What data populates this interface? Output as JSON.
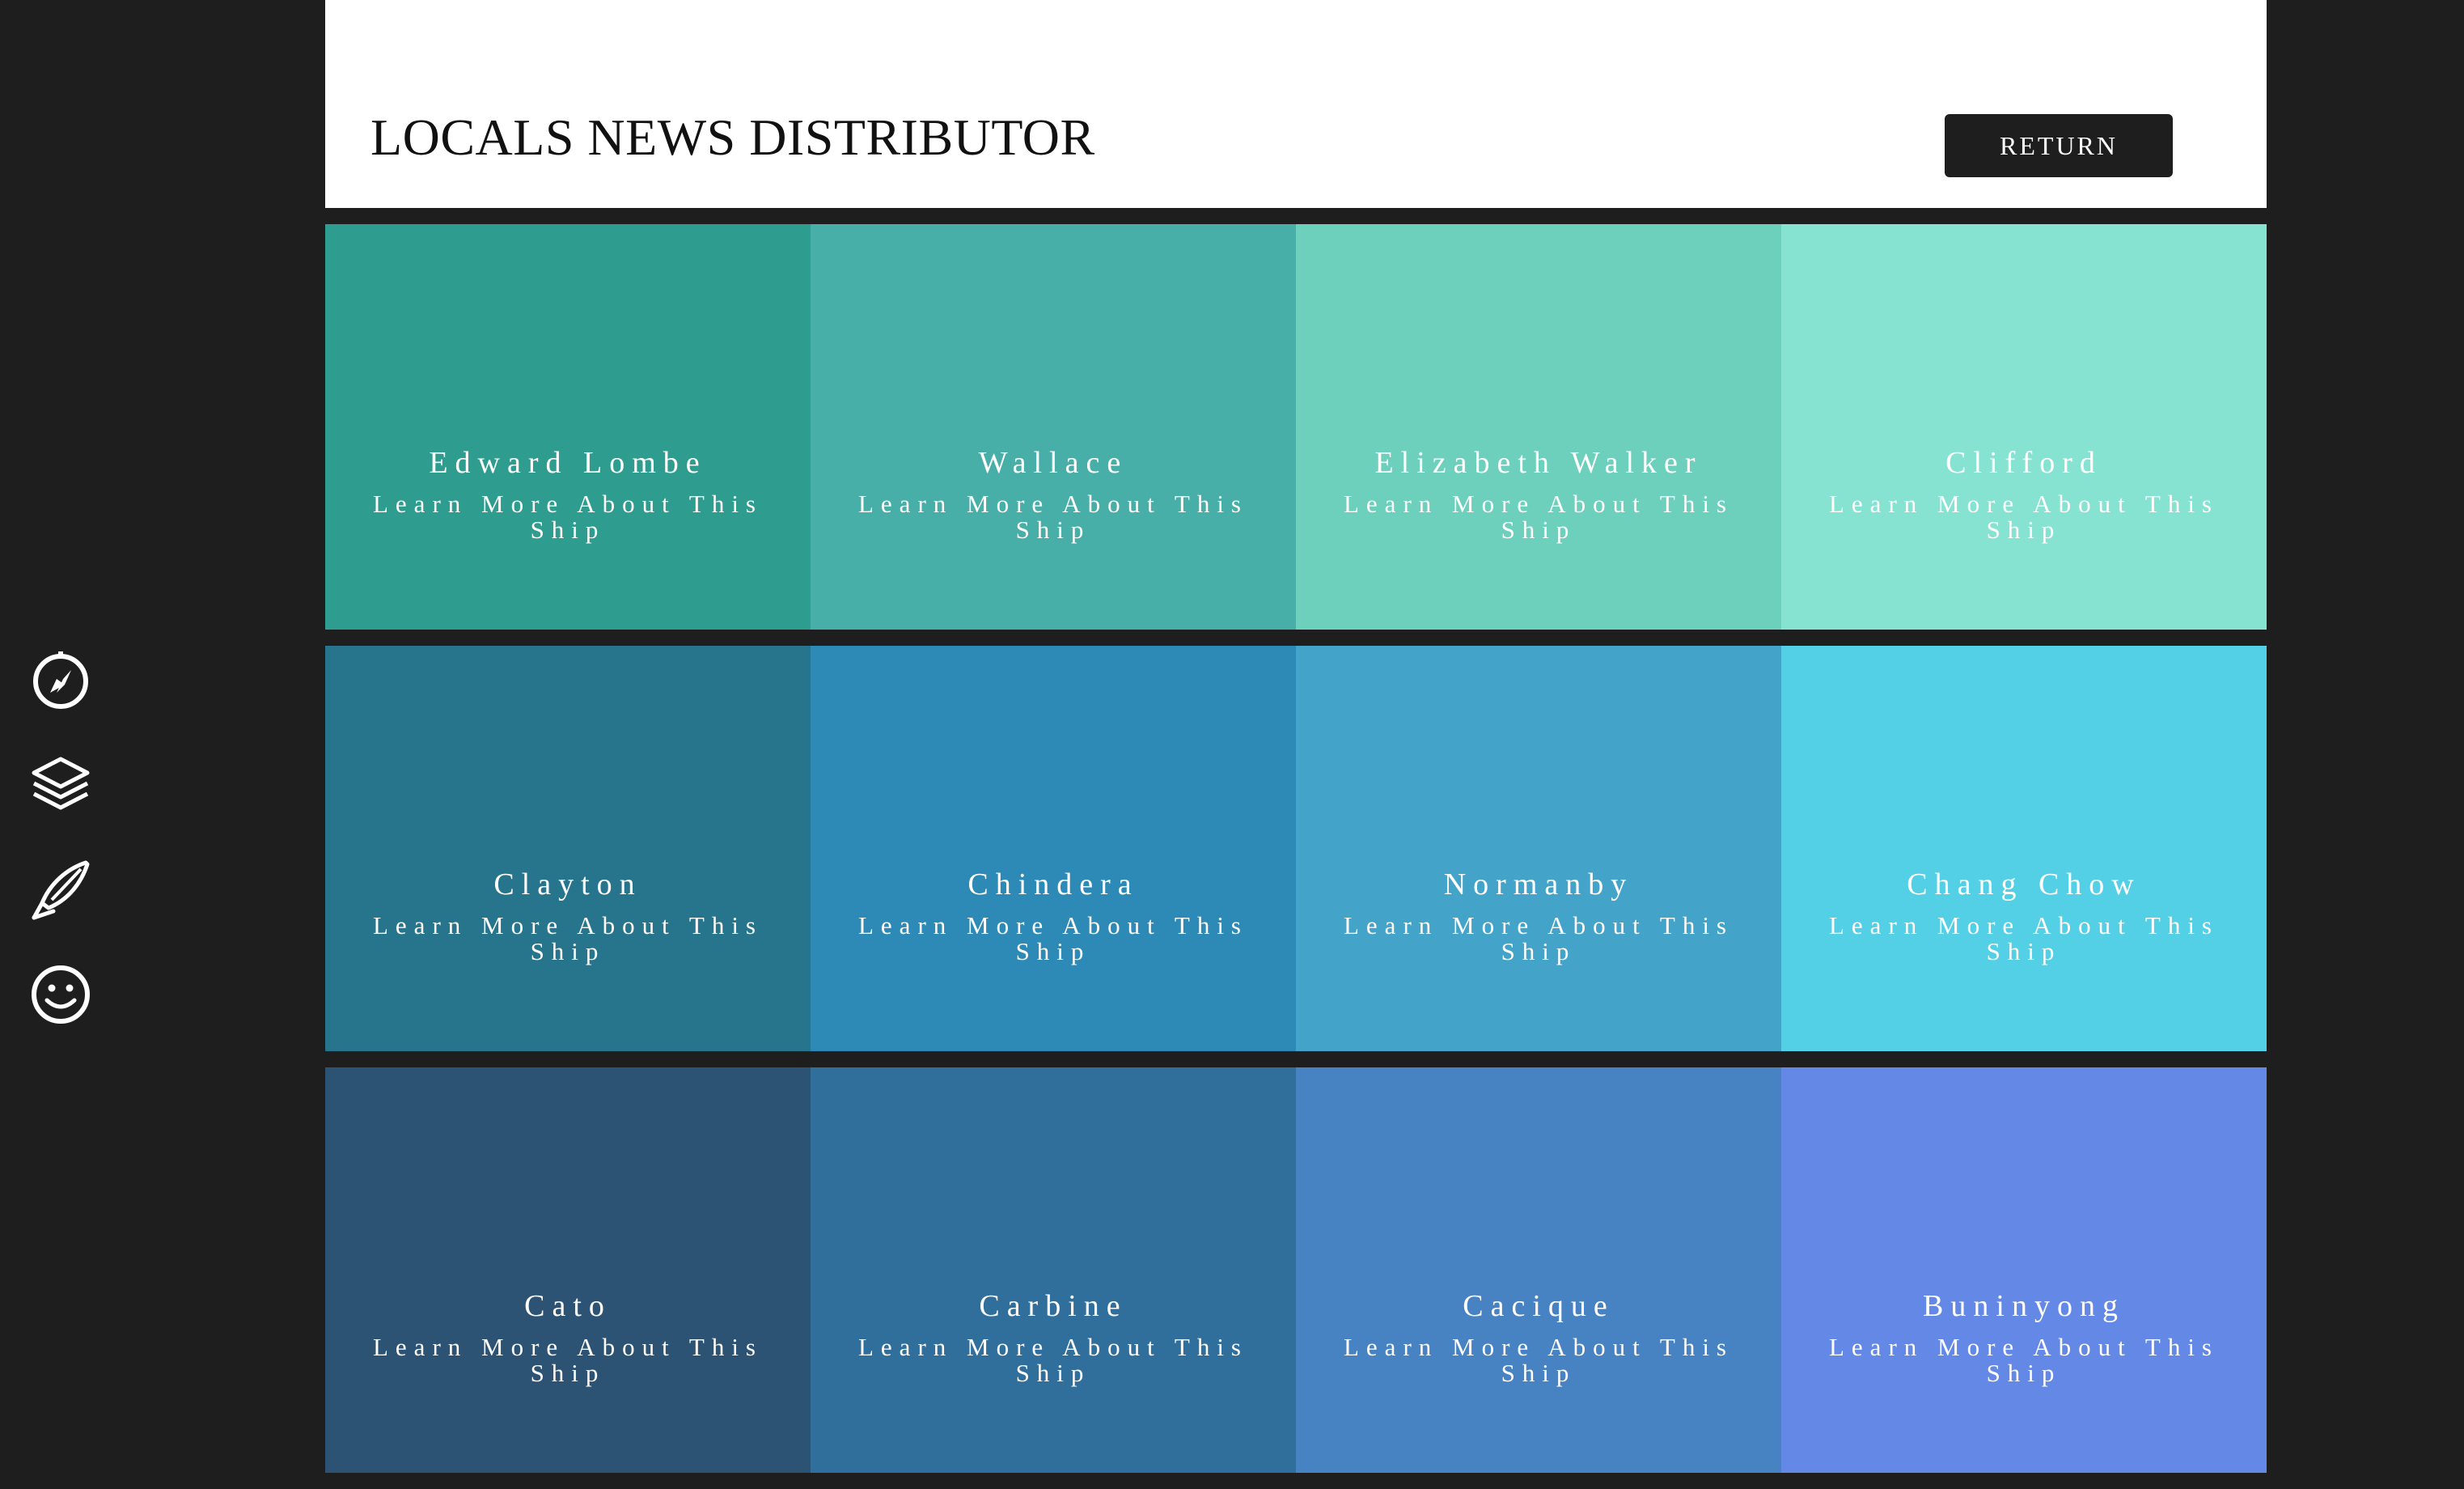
{
  "header": {
    "title": "LOCALS NEWS DISTRIBUTOR",
    "return_label": "RETURN"
  },
  "sidebar": {
    "icons": [
      "compass-icon",
      "layers-icon",
      "pen-icon",
      "smiley-icon"
    ]
  },
  "grid": {
    "link_label": "Learn More About This Ship",
    "tiles": [
      {
        "name": "Edward Lombe",
        "color": "#2e9c8e"
      },
      {
        "name": "Wallace",
        "color": "#47aea8"
      },
      {
        "name": "Elizabeth Walker",
        "color": "#6cd0bc"
      },
      {
        "name": "Clifford",
        "color": "#87e3d1"
      },
      {
        "name": "Clayton",
        "color": "#27758c"
      },
      {
        "name": "Chindera",
        "color": "#2d8ab6"
      },
      {
        "name": "Normanby",
        "color": "#43a3c9"
      },
      {
        "name": "Chang Chow",
        "color": "#53d0e6"
      },
      {
        "name": "Cato",
        "color": "#2c5274"
      },
      {
        "name": "Carbine",
        "color": "#306e9b"
      },
      {
        "name": "Cacique",
        "color": "#4782c2"
      },
      {
        "name": "Buninyong",
        "color": "#6488e5"
      }
    ]
  }
}
